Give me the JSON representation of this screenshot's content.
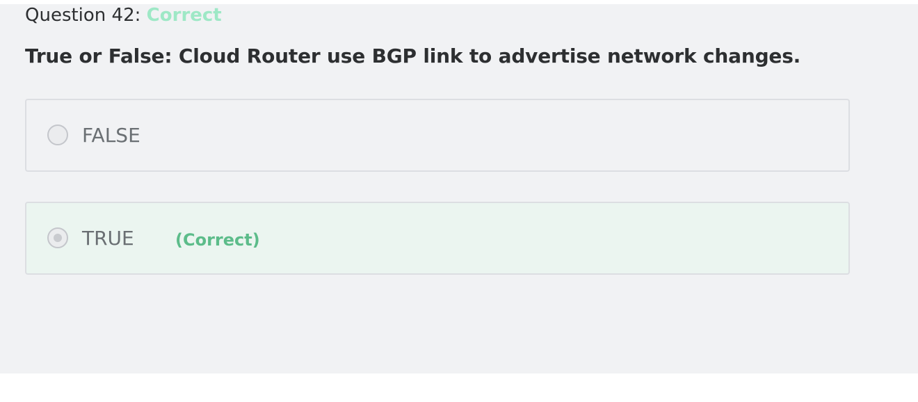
{
  "question": {
    "label": "Question 42:",
    "status": "Correct",
    "text": "True or False: Cloud Router use BGP link to advertise network changes."
  },
  "options": [
    {
      "label": "FALSE",
      "selected": false,
      "tag": ""
    },
    {
      "label": "TRUE",
      "selected": true,
      "tag": "(Correct)"
    }
  ],
  "colors": {
    "status_correct": "#9ee8c6",
    "correct_tag": "#5cbc8a",
    "correct_option_bg": "#ebf5f0",
    "panel_bg": "#f1f2f4"
  }
}
